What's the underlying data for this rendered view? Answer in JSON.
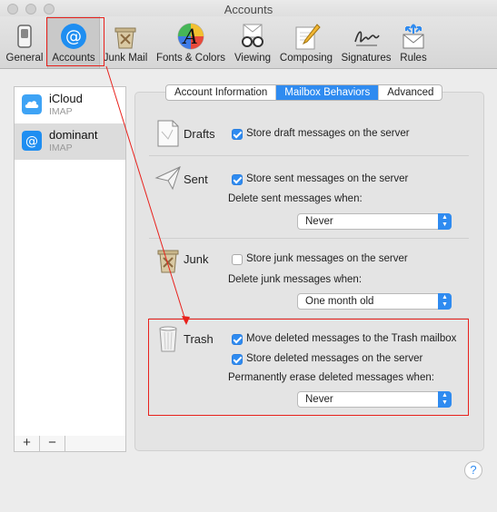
{
  "window": {
    "title": "Accounts"
  },
  "toolbar": {
    "items": [
      {
        "label": "General",
        "icon": "switch-icon"
      },
      {
        "label": "Accounts",
        "icon": "at-sign-icon",
        "selected": true
      },
      {
        "label": "Junk Mail",
        "icon": "junk-bin-icon"
      },
      {
        "label": "Fonts & Colors",
        "icon": "fonts-colors-icon"
      },
      {
        "label": "Viewing",
        "icon": "glasses-icon"
      },
      {
        "label": "Composing",
        "icon": "pencil-paper-icon"
      },
      {
        "label": "Signatures",
        "icon": "signature-icon"
      },
      {
        "label": "Rules",
        "icon": "rules-envelope-icon"
      }
    ]
  },
  "sidebar": {
    "accounts": [
      {
        "name": "iCloud",
        "type": "IMAP",
        "icon": "icloud-icon"
      },
      {
        "name": "dominant",
        "type": "IMAP",
        "icon": "at-sign-icon",
        "selected": true
      }
    ],
    "add_label": "+",
    "remove_label": "−"
  },
  "tabs": {
    "items": [
      {
        "label": "Account Information"
      },
      {
        "label": "Mailbox Behaviors",
        "selected": true
      },
      {
        "label": "Advanced"
      }
    ]
  },
  "drafts": {
    "title": "Drafts",
    "store_label": "Store draft messages on the server",
    "store_checked": true
  },
  "sent": {
    "title": "Sent",
    "store_label": "Store sent messages on the server",
    "store_checked": true,
    "delete_label": "Delete sent messages when:",
    "delete_value": "Never"
  },
  "junk": {
    "title": "Junk",
    "store_label": "Store junk messages on the server",
    "store_checked": false,
    "delete_label": "Delete junk messages when:",
    "delete_value": "One month old"
  },
  "trash": {
    "title": "Trash",
    "move_label": "Move deleted messages to the Trash mailbox",
    "move_checked": true,
    "store_label": "Store deleted messages on the server",
    "store_checked": true,
    "erase_label": "Permanently erase deleted messages when:",
    "erase_value": "Never"
  },
  "help": {
    "label": "?"
  },
  "colors": {
    "accent": "#2f8bf0",
    "annotation": "#e8211c"
  }
}
